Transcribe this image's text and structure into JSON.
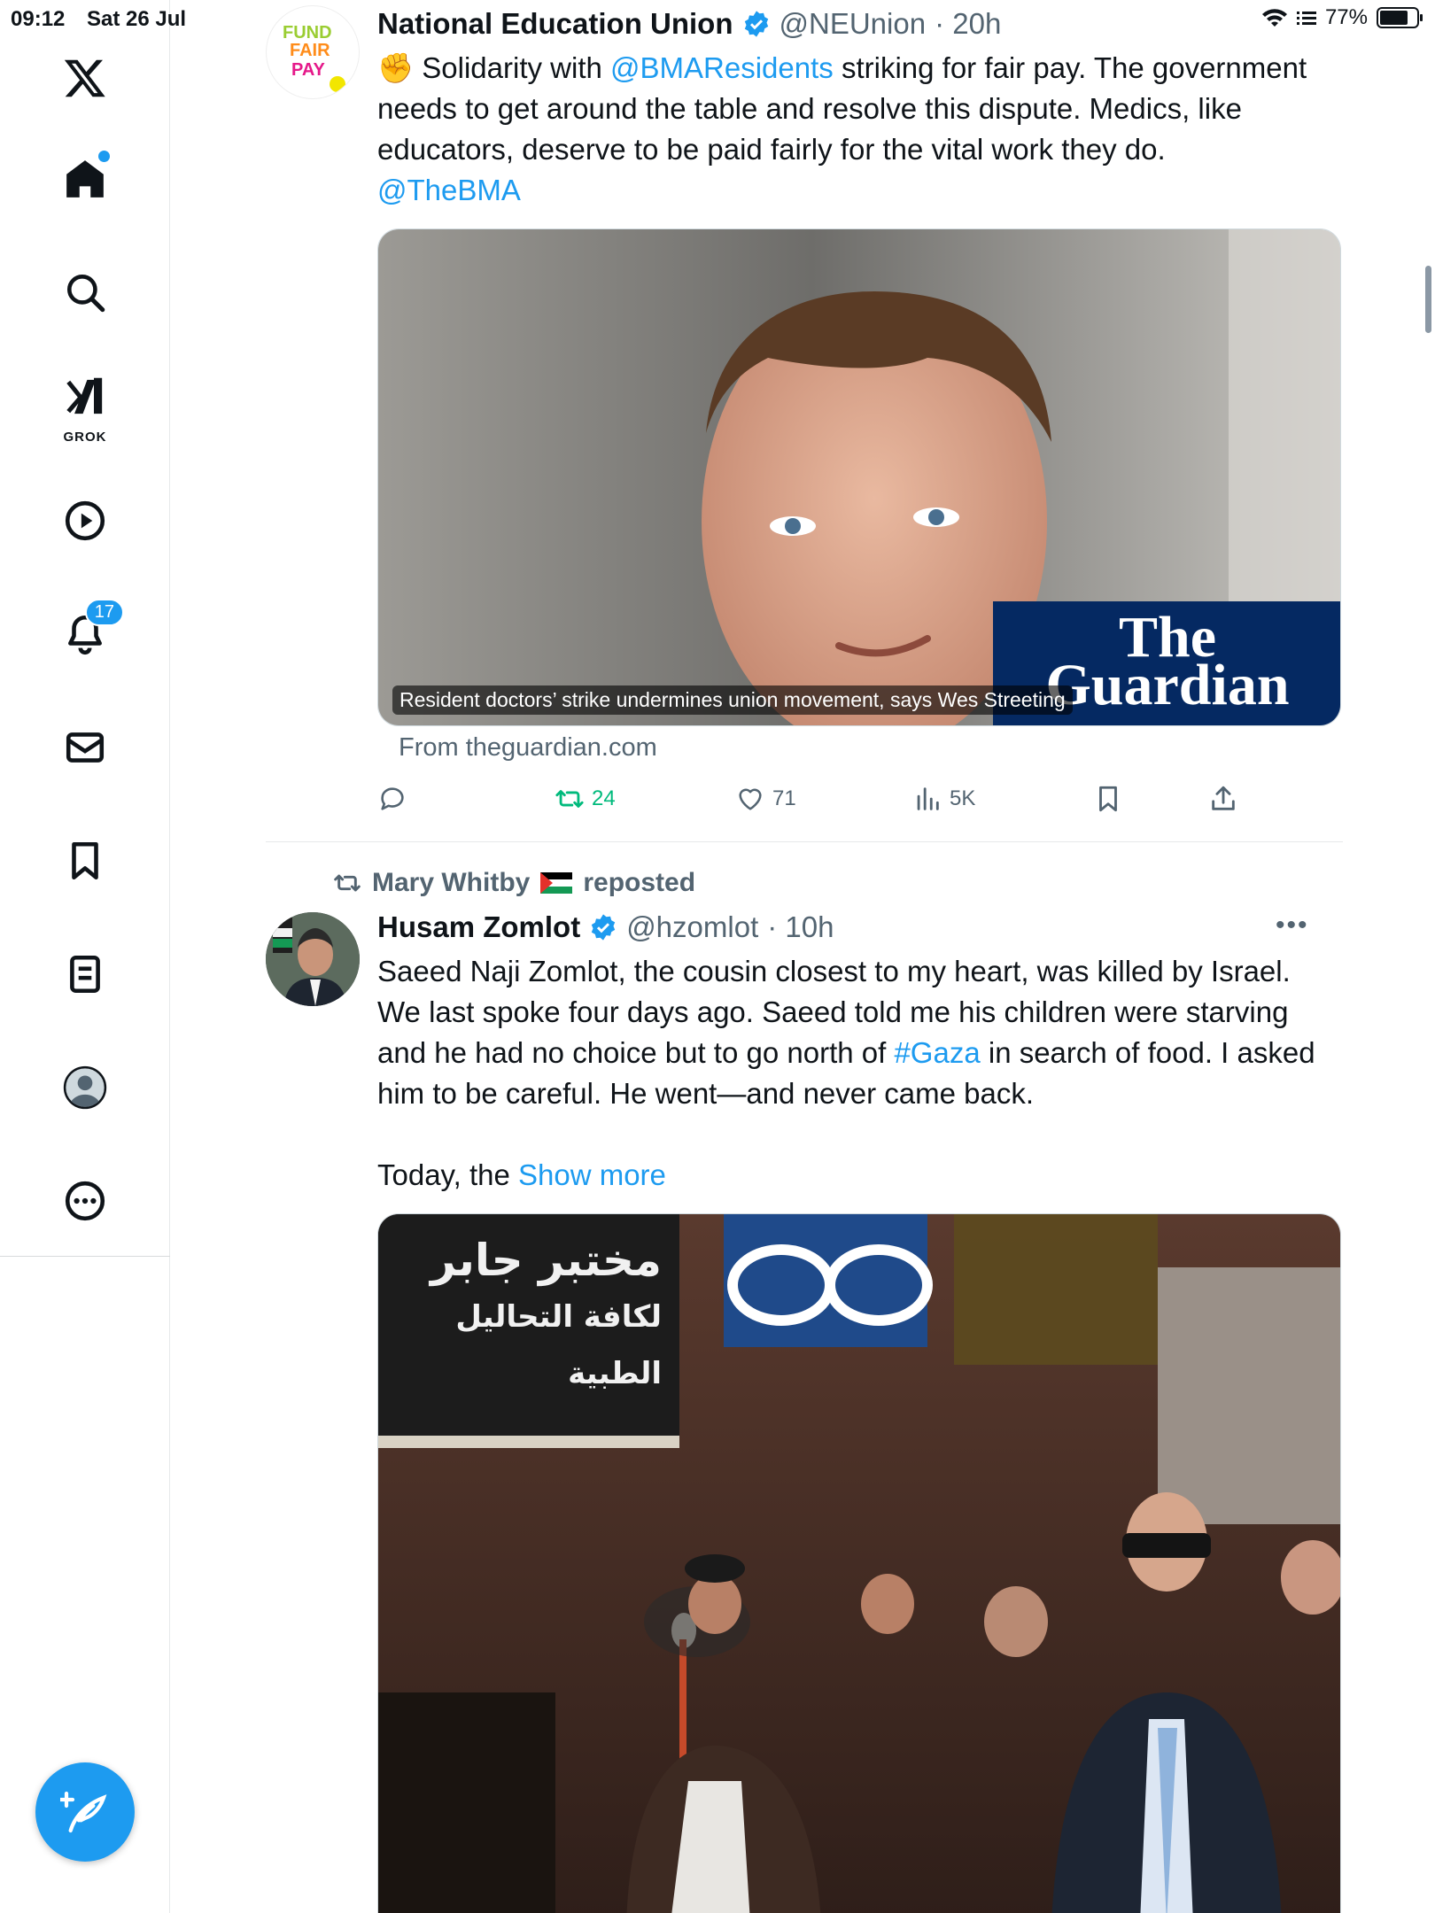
{
  "status_bar": {
    "time": "09:12",
    "date": "Sat 26 Jul",
    "battery": "77%",
    "battery_level": 0.77
  },
  "sidebar": {
    "grok_label": "GROK",
    "notifications_count": "17",
    "icons": [
      "x-logo-icon",
      "home-icon",
      "search-icon",
      "grok-icon",
      "video-icon",
      "notifications-icon",
      "messages-icon",
      "bookmarks-icon",
      "lists-icon",
      "profile-icon",
      "more-icon"
    ]
  },
  "tweets": [
    {
      "display_name": "National Education Union",
      "handle": "@NEUnion",
      "time": "· 20h",
      "avatar_text": [
        "FUND",
        "FAIR",
        "PAY"
      ],
      "text_emoji": "✊",
      "text_parts": {
        "p1": " Solidarity with ",
        "mention1": "@BMAResidents",
        "p2": " striking for fair pay. The government needs to get around the table and resolve this dispute. Medics, like educators, deserve to be paid fairly for the vital work they do.",
        "mention2": "@TheBMA"
      },
      "card": {
        "caption": "Resident doctors’ strike undermines union movement, says Wes Streeting",
        "logo_line1": "The",
        "logo_line2": "Guardian",
        "from": "From theguardian.com"
      },
      "actions": {
        "reposts": "24",
        "likes": "71",
        "views": "5K"
      }
    },
    {
      "reposted_by": "Mary Whitby",
      "reposted_label": "reposted",
      "display_name": "Husam Zomlot",
      "handle": "@hzomlot",
      "time": "· 10h",
      "text_parts": {
        "p1": "Saeed Naji Zomlot, the cousin closest to my heart, was killed by Israel. We last spoke four days ago. Saeed told me his children were starving and he had no choice but to go north of ",
        "hashtag": "#Gaza",
        "p2": " in search of food. I asked him to be careful. He went—and never came back.",
        "p3": "Today, the ",
        "show_more": "Show more"
      },
      "image_signs": [
        "مختبر جابر",
        "لكافة التحاليل الطبية"
      ]
    }
  ],
  "colors": {
    "accent": "#1d9bf0",
    "repost_green": "#00ba7c",
    "text": "#0f1419",
    "muted": "#536471"
  }
}
